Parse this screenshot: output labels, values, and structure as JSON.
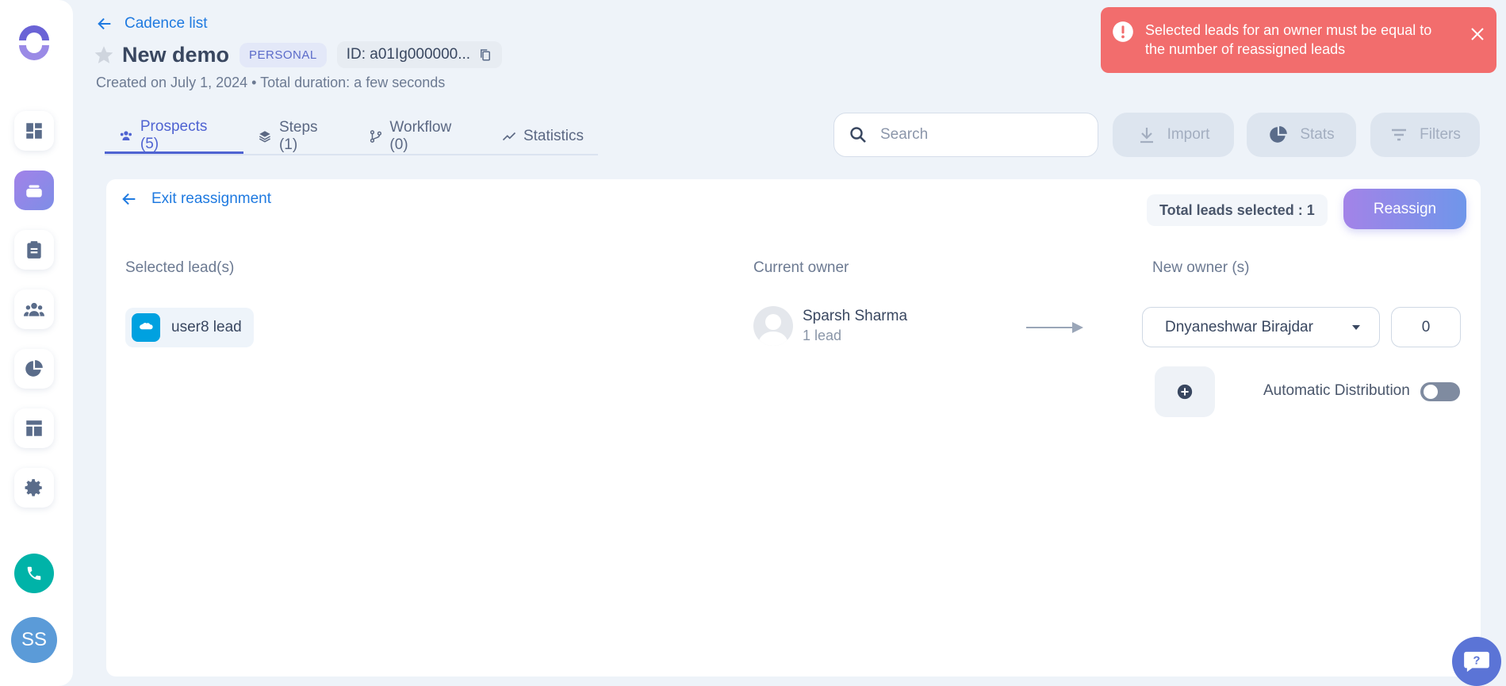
{
  "header": {
    "back_label": "Cadence list",
    "title": "New demo",
    "badge": "PERSONAL",
    "id_text": "ID: a01Ig000000...",
    "subtitle": "Created on July 1, 2024 • Total duration: a few seconds"
  },
  "tabs": [
    {
      "label": "Prospects (5)",
      "icon": "people-icon",
      "active": true
    },
    {
      "label": "Steps (1)",
      "icon": "layers-icon",
      "active": false
    },
    {
      "label": "Workflow (0)",
      "icon": "branch-icon",
      "active": false
    },
    {
      "label": "Statistics",
      "icon": "trend-icon",
      "active": false
    }
  ],
  "toolbar": {
    "search_placeholder": "Search",
    "import_label": "Import",
    "stats_label": "Stats",
    "filters_label": "Filters"
  },
  "toast": {
    "message": "Selected leads for an owner must be equal to the number of reassigned leads",
    "color": "#f26d6d"
  },
  "reassignment": {
    "exit_label": "Exit reassignment",
    "total_label": "Total leads selected : 1",
    "reassign_label": "Reassign",
    "col_selected": "Selected lead(s)",
    "col_current": "Current owner",
    "col_new": "New owner (s)",
    "lead_name": "user8 lead",
    "current_owner_name": "Sparsh Sharma",
    "current_owner_count": "1 lead",
    "new_owner_value": "Dnyaneshwar Birajdar",
    "new_owner_count": "0",
    "auto_label": "Automatic Distribution",
    "auto_enabled": false
  },
  "sidebar": {
    "items": [
      "dashboard-icon",
      "cadence-icon",
      "tasks-icon",
      "people-icon",
      "pie-chart-icon",
      "template-icon",
      "settings-icon"
    ],
    "active_index": 1,
    "user_initials": "SS"
  },
  "colors": {
    "accent": "#4f63d2",
    "link": "#1f7ae0",
    "call": "#00b3a8"
  }
}
